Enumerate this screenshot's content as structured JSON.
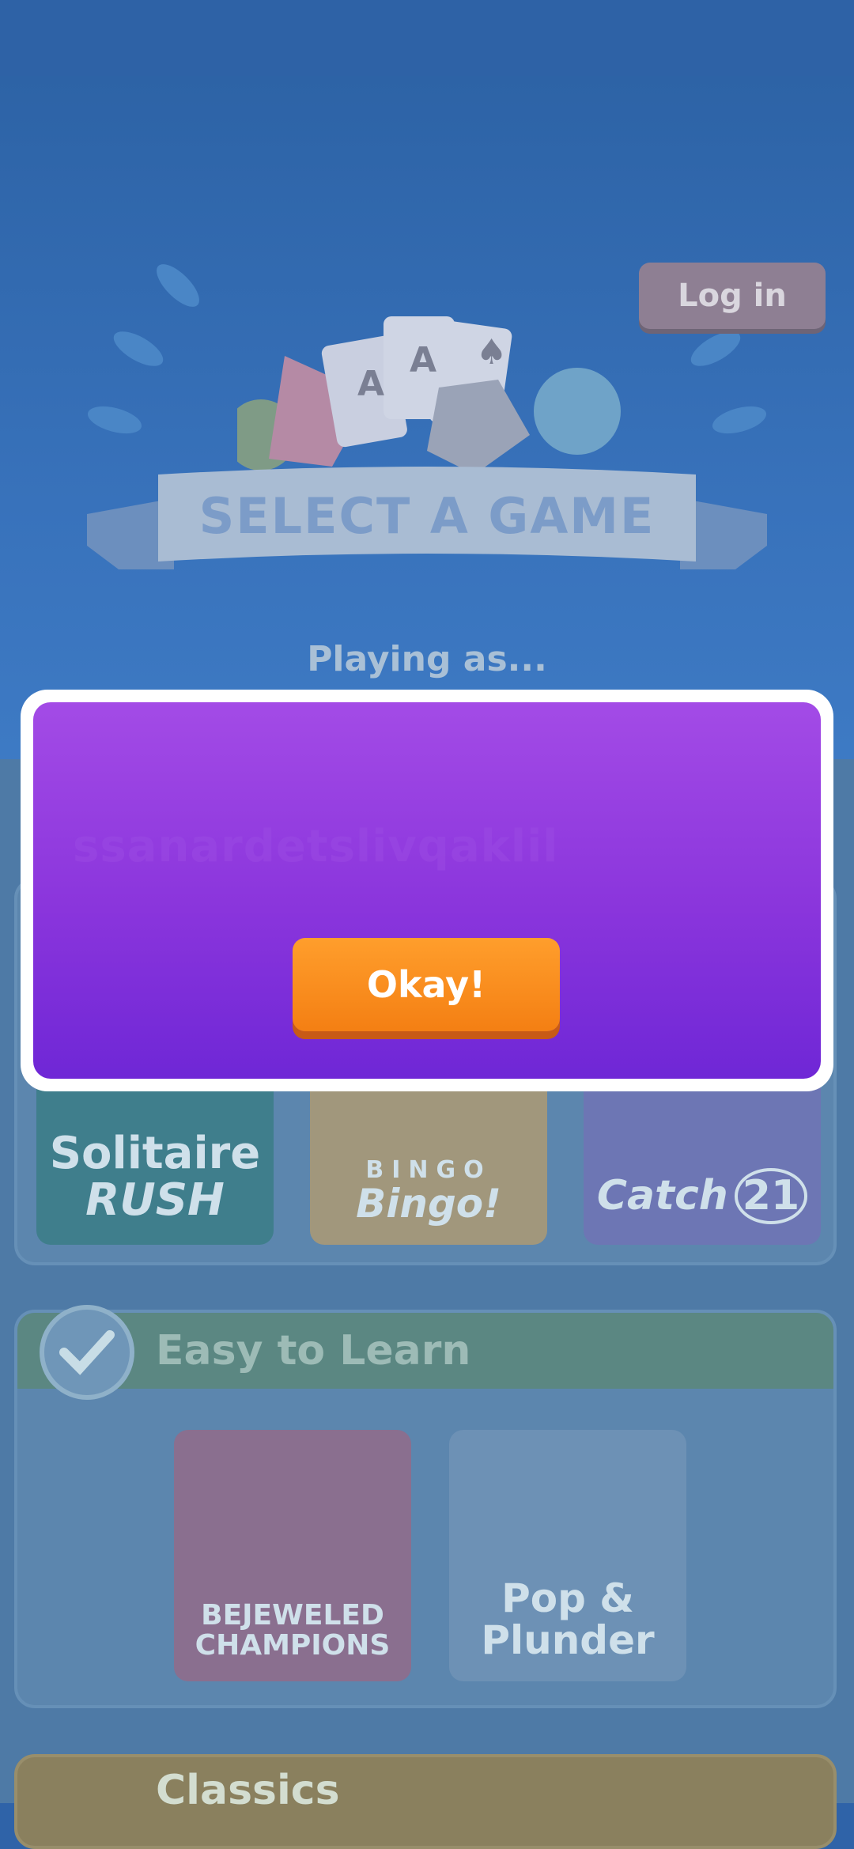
{
  "header": {
    "login_label": "Log in",
    "banner_title": "SELECT A GAME",
    "playing_as": "Playing as..."
  },
  "featured_games": [
    {
      "line1": "Solitaire",
      "line2": "RUSH"
    },
    {
      "line1": "BINGO",
      "line2": "Bingo!"
    },
    {
      "line1": "Catch",
      "line2": "21"
    }
  ],
  "sections": [
    {
      "title": "Easy to Learn",
      "games": [
        {
          "line1": "BEJEWELED",
          "line2": "CHAMPIONS"
        },
        {
          "line1": "Pop &",
          "line2": "Plunder"
        }
      ]
    },
    {
      "title": "Classics"
    }
  ],
  "dialog": {
    "ghost_text": "ssanardetslivqaklil",
    "okay_label": "Okay!"
  },
  "colors": {
    "dialog_top": "#a34be6",
    "dialog_bottom": "#6f27d6",
    "button_orange": "#f47f13"
  }
}
